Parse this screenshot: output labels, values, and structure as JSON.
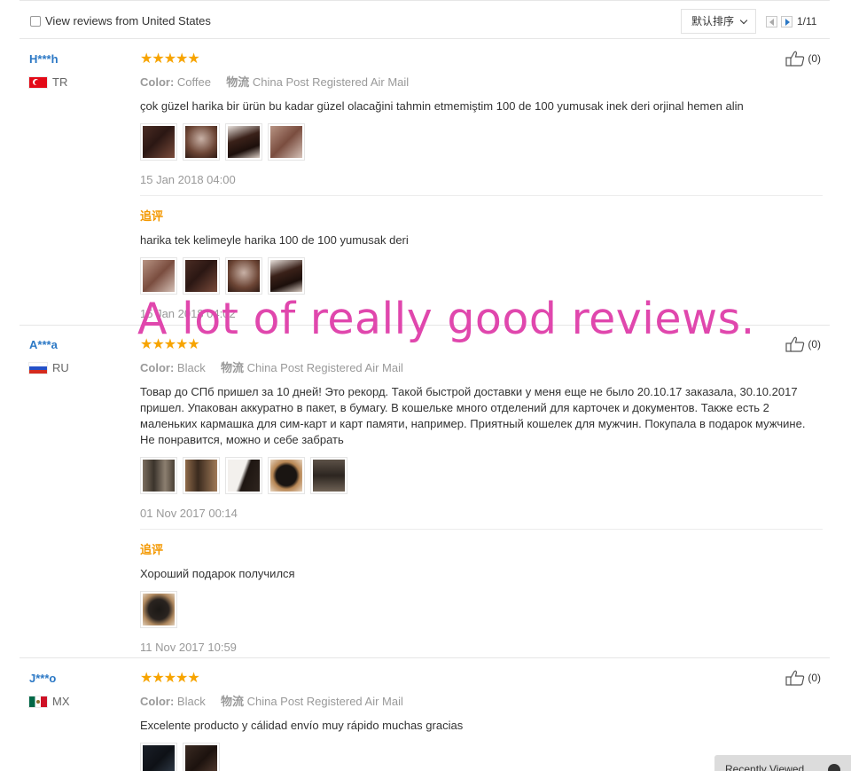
{
  "toolbar": {
    "filter_label": "View reviews from United States",
    "sort_label": "默认排序",
    "page_indicator": "1/11"
  },
  "overlay_text": "A lot of really good reviews.",
  "recently_viewed_label": "Recently Viewed",
  "reviews": [
    {
      "user": "H***h",
      "country": "TR",
      "stars": "★★★★★",
      "color_label": "Color:",
      "color_value": "Coffee",
      "shipping_label": "物流",
      "shipping_value": "China Post Registered Air Mail",
      "text": "çok güzel harika bir ürün bu kadar güzel olacağini tahmin etmemiştim 100 de 100 yumusak inek deri orjinal hemen alin",
      "date": "15 Jan 2018 04:00",
      "likes": "(0)",
      "followup": {
        "label": "追评",
        "text": "harika tek kelimeyle harika 100 de 100 yumusak deri",
        "date": "15 Jan 2018 04:02"
      }
    },
    {
      "user": "A***a",
      "country": "RU",
      "stars": "★★★★★",
      "color_label": "Color:",
      "color_value": "Black",
      "shipping_label": "物流",
      "shipping_value": "China Post Registered Air Mail",
      "text": "Товар до СПб пришел за 10 дней! Это рекорд. Такой быстрой доставки у меня еще не было 20.10.17 заказала, 30.10.2017 пришел. Упакован аккуратно в пакет, в бумагу. В кошельке много отделений для карточек и документов. Также есть 2 маленьких кармашка для сим-карт и карт памяти, например. Приятный кошелек для мужчин. Покупала в подарок мужчине. Не понравится, можно и себе забрать",
      "date": "01 Nov 2017 00:14",
      "likes": "(0)",
      "followup": {
        "label": "追评",
        "text": "Хороший подарок получился",
        "date": "11 Nov 2017 10:59"
      }
    },
    {
      "user": "J***o",
      "country": "MX",
      "stars": "★★★★★",
      "color_label": "Color:",
      "color_value": "Black",
      "shipping_label": "物流",
      "shipping_value": "China Post Registered Air Mail",
      "text": "Excelente producto y cálidad envío muy rápido muchas gracias",
      "likes": "(0)"
    }
  ]
}
